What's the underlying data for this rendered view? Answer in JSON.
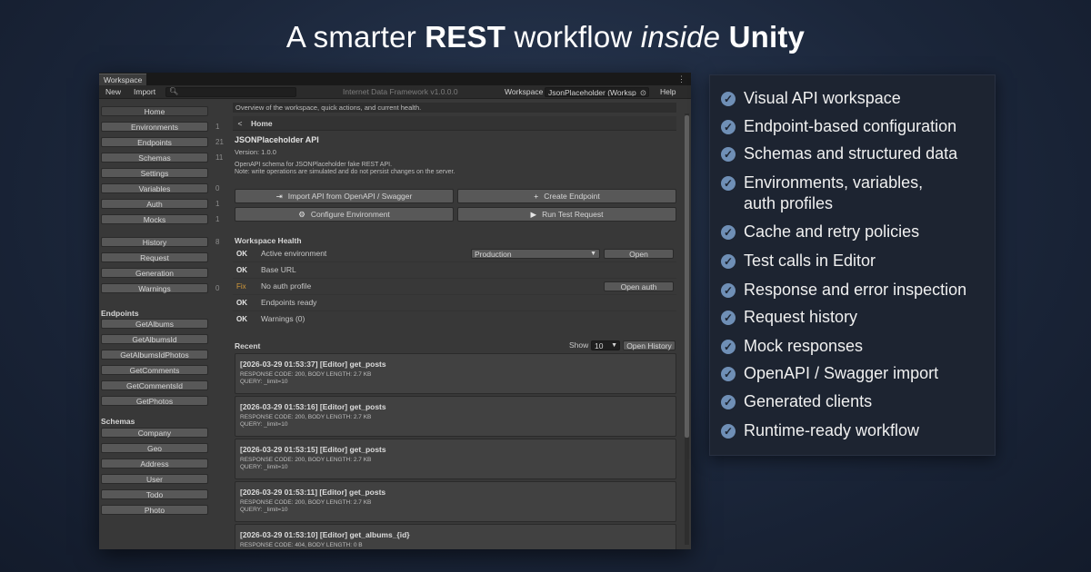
{
  "headline": {
    "part1": "A smarter ",
    "bold1": "REST",
    "part2": " workflow ",
    "italic": "inside",
    "part3": " ",
    "bold2": "Unity"
  },
  "window": {
    "tab": "Workspace",
    "kebab": "⋮",
    "toolbar": {
      "new_label": "New",
      "import_label": "Import",
      "search_placeholder": "",
      "center_title": "Internet Data Framework v1.0.0.0",
      "workspace_label": "Workspace",
      "workspace_value": "JsonPlaceholder (Worksp",
      "help_label": "Help"
    },
    "sidebar": {
      "items": [
        {
          "label": "Home",
          "count": ""
        },
        {
          "label": "Environments",
          "count": "1"
        },
        {
          "label": "Endpoints",
          "count": "21"
        },
        {
          "label": "Schemas",
          "count": "11"
        },
        {
          "label": "Settings",
          "count": ""
        },
        {
          "label": "Variables",
          "count": "0"
        },
        {
          "label": "Auth",
          "count": "1"
        },
        {
          "label": "Mocks",
          "count": "1"
        },
        {
          "label": "History",
          "count": "8"
        },
        {
          "label": "Request",
          "count": ""
        },
        {
          "label": "Generation",
          "count": ""
        },
        {
          "label": "Warnings",
          "count": "0"
        }
      ],
      "endpoints_heading": "Endpoints",
      "endpoints": [
        "GetAlbums",
        "GetAlbumsId",
        "GetAlbumsIdPhotos",
        "GetComments",
        "GetCommentsId",
        "GetPhotos"
      ],
      "schemas_heading": "Schemas",
      "schemas": [
        "Company",
        "Geo",
        "Address",
        "User",
        "Todo",
        "Photo"
      ]
    },
    "main": {
      "overview": "Overview of the workspace, quick actions, and current health.",
      "back_label": "<",
      "breadcrumb": "Home",
      "api_title": "JSONPlaceholder API",
      "api_version": "Version: 1.0.0",
      "api_desc1": "OpenAPI schema for JSONPlaceholder fake REST API.",
      "api_desc2": "Note: write operations are simulated and do not persist changes on the server.",
      "actions": [
        {
          "icon": "⇥",
          "label": "Import API from OpenAPI / Swagger"
        },
        {
          "icon": "+",
          "label": "Create Endpoint"
        },
        {
          "icon": "⚙",
          "label": "Configure Environment"
        },
        {
          "icon": "▶",
          "label": "Run Test Request"
        }
      ],
      "health_title": "Workspace Health",
      "health": [
        {
          "status": "OK",
          "label": "Active environment",
          "dropdown": "Production",
          "button": "Open"
        },
        {
          "status": "OK",
          "label": "Base URL",
          "dropdown": "",
          "button": ""
        },
        {
          "status": "Fix",
          "label": "No auth profile",
          "dropdown": "",
          "button": "Open auth"
        },
        {
          "status": "OK",
          "label": "Endpoints ready",
          "dropdown": "",
          "button": ""
        },
        {
          "status": "OK",
          "label": "Warnings (0)",
          "dropdown": "",
          "button": ""
        }
      ],
      "recent_title": "Recent",
      "show_label": "Show",
      "show_value": "10",
      "open_history": "Open History",
      "recent": [
        {
          "title": "[2026-03-29 01:53:37] [Editor] get_posts",
          "line1": "RESPONSE CODE: 200, BODY LENGTH: 2.7 KB",
          "line2": "QUERY: _limit=10"
        },
        {
          "title": "[2026-03-29 01:53:16] [Editor] get_posts",
          "line1": "RESPONSE CODE: 200, BODY LENGTH: 2.7 KB",
          "line2": "QUERY: _limit=10"
        },
        {
          "title": "[2026-03-29 01:53:15] [Editor] get_posts",
          "line1": "RESPONSE CODE: 200, BODY LENGTH: 2.7 KB",
          "line2": "QUERY: _limit=10"
        },
        {
          "title": "[2026-03-29 01:53:11] [Editor] get_posts",
          "line1": "RESPONSE CODE: 200, BODY LENGTH: 2.7 KB",
          "line2": "QUERY: _limit=10"
        },
        {
          "title": "[2026-03-29 01:53:10] [Editor] get_albums_{id}",
          "line1": "RESPONSE CODE: 404, BODY LENGTH: 0 B",
          "line2": ""
        }
      ]
    }
  },
  "features": [
    "Visual API workspace",
    "Endpoint-based configuration",
    "Schemas and structured data",
    "Environments, variables, auth profiles",
    "Cache and retry policies",
    "Test calls in Editor",
    "Response and error inspection",
    "Request history",
    "Mock responses",
    "OpenAPI / Swagger import",
    "Generated clients",
    "Runtime-ready workflow"
  ],
  "colors": {
    "accent_check": "#6f8fb6",
    "fix_status": "#d49a3a",
    "panel_bg": "#1d2431"
  }
}
